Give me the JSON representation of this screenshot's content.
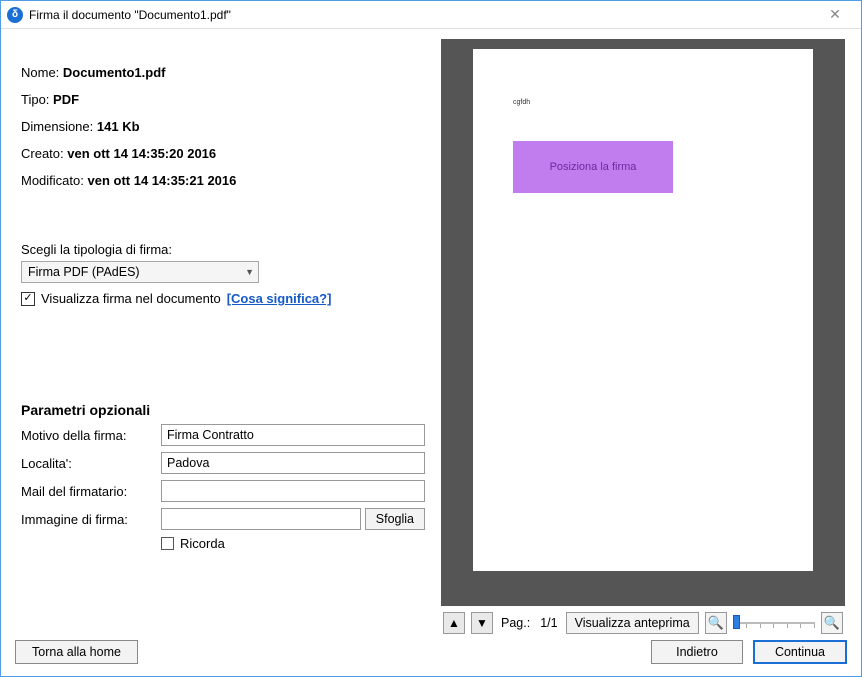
{
  "window": {
    "title": "Firma il documento \"Documento1.pdf\""
  },
  "meta": {
    "name_label": "Nome:",
    "name_value": "Documento1.pdf",
    "type_label": "Tipo:",
    "type_value": "PDF",
    "size_label": "Dimensione:",
    "size_value": "141 Kb",
    "created_label": "Creato:",
    "created_value": "ven ott 14 14:35:20 2016",
    "modified_label": "Modificato:",
    "modified_value": "ven ott 14 14:35:21 2016"
  },
  "sigtype": {
    "label": "Scegli la tipologia di firma:",
    "selected": "Firma PDF (PAdES)",
    "show_in_doc_label": "Visualizza firma nel documento",
    "what_link": "[Cosa significa?]",
    "show_in_doc_checked": true
  },
  "optional": {
    "heading": "Parametri opzionali",
    "reason_label": "Motivo della firma:",
    "reason_value": "Firma Contratto",
    "locality_label": "Localita':",
    "locality_value": "Padova",
    "email_label": "Mail del firmatario:",
    "email_value": "",
    "image_label": "Immagine di firma:",
    "image_value": "",
    "browse_label": "Sfoglia",
    "remember_label": "Ricorda",
    "remember_checked": false
  },
  "preview": {
    "page_text": "cgfdh",
    "sigbox_label": "Posiziona la firma",
    "pag_label": "Pag.:",
    "pag_value": "1/1",
    "preview_btn": "Visualizza anteprima"
  },
  "footer": {
    "home_label": "Torna alla home",
    "back_label": "Indietro",
    "continue_label": "Continua"
  }
}
